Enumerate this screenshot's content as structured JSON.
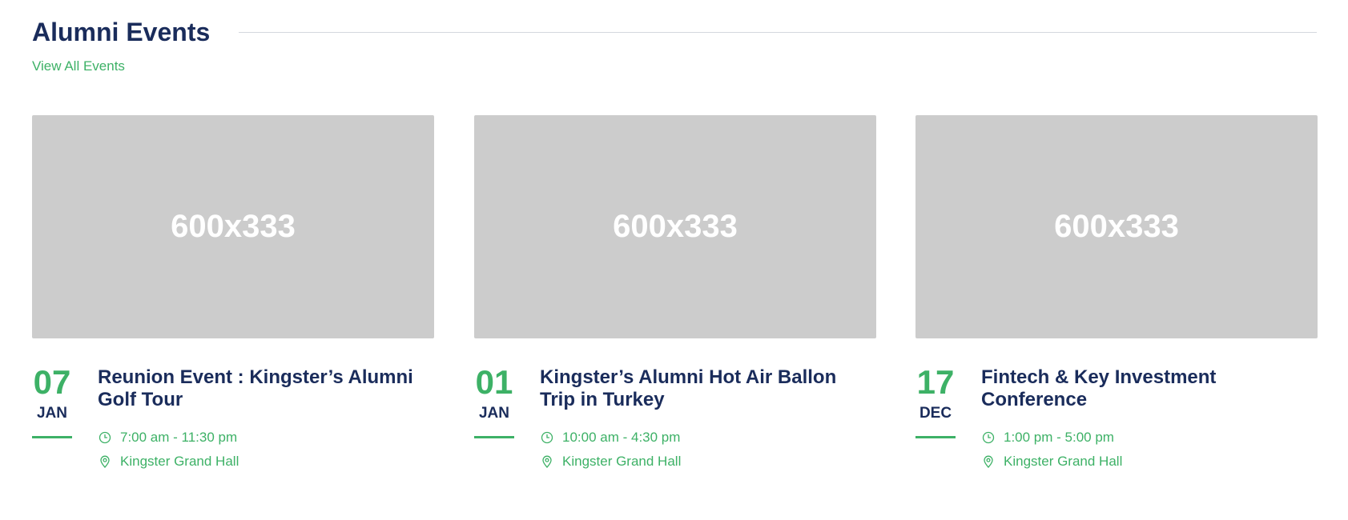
{
  "section": {
    "title": "Alumni Events",
    "view_all_label": "View All Events"
  },
  "colors": {
    "accent": "#3db166",
    "heading": "#1a2c5b",
    "placeholder_bg": "#cccccc"
  },
  "events": [
    {
      "image_label": "600x333",
      "day": "07",
      "month": "JAN",
      "title": "Reunion Event : Kingster’s Alumni Golf Tour",
      "time": "7:00 am - 11:30 pm",
      "location": "Kingster Grand Hall",
      "time_icon": "clock-icon",
      "location_icon": "map-pin-icon"
    },
    {
      "image_label": "600x333",
      "day": "01",
      "month": "JAN",
      "title": "Kingster’s Alumni Hot Air Ballon Trip in Turkey",
      "time": "10:00 am - 4:30 pm",
      "location": "Kingster Grand Hall",
      "time_icon": "clock-icon",
      "location_icon": "map-pin-icon"
    },
    {
      "image_label": "600x333",
      "day": "17",
      "month": "DEC",
      "title": "Fintech & Key Investment Conference",
      "time": "1:00 pm - 5:00 pm",
      "location": "Kingster Grand Hall",
      "time_icon": "clock-icon",
      "location_icon": "map-pin-icon"
    }
  ]
}
